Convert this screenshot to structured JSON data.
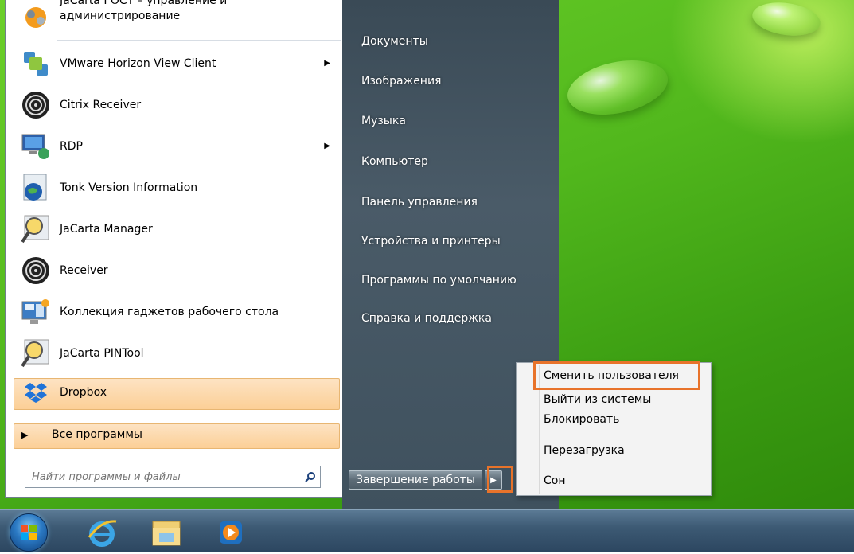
{
  "programs": [
    {
      "label_line1": "JaCarta ГОСТ – управление и",
      "label_line2": "администрирование",
      "icon": "jacarta-gost-icon"
    },
    {
      "label": "VMware Horizon View Client",
      "icon": "vmware-icon",
      "submenu": true
    },
    {
      "label": "Citrix Receiver",
      "icon": "citrix-receiver-icon"
    },
    {
      "label": "RDP",
      "icon": "rdp-icon",
      "submenu": true
    },
    {
      "label": "Tonk Version Information",
      "icon": "globe-icon"
    },
    {
      "label": "JaCarta Manager",
      "icon": "magnifier-icon"
    },
    {
      "label": "Receiver",
      "icon": "receiver-icon"
    },
    {
      "label": "Коллекция гаджетов рабочего стола",
      "icon": "gadgets-icon"
    },
    {
      "label": "JaCarta PINTool",
      "icon": "magnifier-icon"
    },
    {
      "label": "Dropbox",
      "icon": "dropbox-icon"
    }
  ],
  "all_programs": "Все программы",
  "search": {
    "placeholder": "Найти программы и файлы"
  },
  "right_items": [
    "Документы",
    "Изображения",
    "Музыка",
    "Компьютер",
    "Панель управления",
    "Устройства и принтеры",
    "Программы по умолчанию",
    "Справка и поддержка"
  ],
  "shutdown": {
    "label": "Завершение работы"
  },
  "context_menu": {
    "switch_user": "Сменить пользователя",
    "log_off": "Выйти из системы",
    "lock": "Блокировать",
    "restart": "Перезагрузка",
    "sleep": "Сон"
  },
  "colors": {
    "highlight_box": "#e8732a",
    "menu_hover": "#fccf96"
  }
}
